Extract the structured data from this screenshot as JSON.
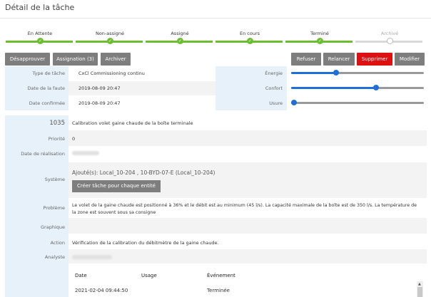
{
  "page": {
    "title": "Détail de la tâche"
  },
  "steps": [
    {
      "label": "En Attente",
      "done": true
    },
    {
      "label": "Non-assigné",
      "done": true
    },
    {
      "label": "Assigné",
      "done": true
    },
    {
      "label": "En cours",
      "done": true
    },
    {
      "label": "Terminé",
      "done": true
    },
    {
      "label": "Archivé",
      "done": false
    }
  ],
  "check_glyph": "✓",
  "toolbar": {
    "disapprove": "Désapprouver",
    "assignation": "Assignation (3)",
    "archive": "Archiver",
    "refuse": "Refuser",
    "relaunch": "Relancer",
    "delete": "Supprimer",
    "modify": "Modifier"
  },
  "colors": {
    "green": "#6bbe2f",
    "red": "#dd1111",
    "blue": "#1f6fd6",
    "button": "#7e7e7e"
  },
  "info": {
    "type_label": "Type de tâche",
    "type_value": "CxCl Commissioning continu",
    "fault_label": "Date de la faute",
    "fault_value": "2019-08-09 20:47",
    "confirmed_label": "Date confirmée",
    "confirmed_value": "2019-08-09 20:47"
  },
  "ratings": {
    "energy_label": "Énergie",
    "energy_level": 0.34,
    "comfort_label": "Confort",
    "comfort_level": 0.64,
    "wear_label": "Usure",
    "wear_level": 0.0
  },
  "detail": {
    "id": "1035",
    "name": "Calibration volet gaine chaude de la boîte terminale",
    "priority_label": "Priorité",
    "priority_value": "0",
    "realisation_label": "Date de réalisation",
    "system_label": "Système",
    "system_value": "Ajouté(s): Local_10-204 , 10-BYD-07-E (Local_10-204)",
    "create_button": "Créer tâche pour chaque entité",
    "problem_label": "Problème",
    "problem_value": "Le volet de la gaine chaude est positionné à 36% et le débit est au minimum (45 l/s). La capacité maximale de la boîte est de 350 l/s. La température de la zone est souvent sous sa consigne",
    "graph_label": "Graphique",
    "action_label": "Action",
    "action_value": "Vérification de la calibration du débitmètre de la gaine chaude.",
    "analyst_label": "Analyste"
  },
  "events": {
    "headers": {
      "date": "Date",
      "usage": "Usage",
      "event": "Événement"
    },
    "rows": [
      {
        "date": "2021-02-04 09:44:50",
        "usage": "",
        "event": "Terminée"
      }
    ]
  },
  "scroll_up_glyph": "▲"
}
